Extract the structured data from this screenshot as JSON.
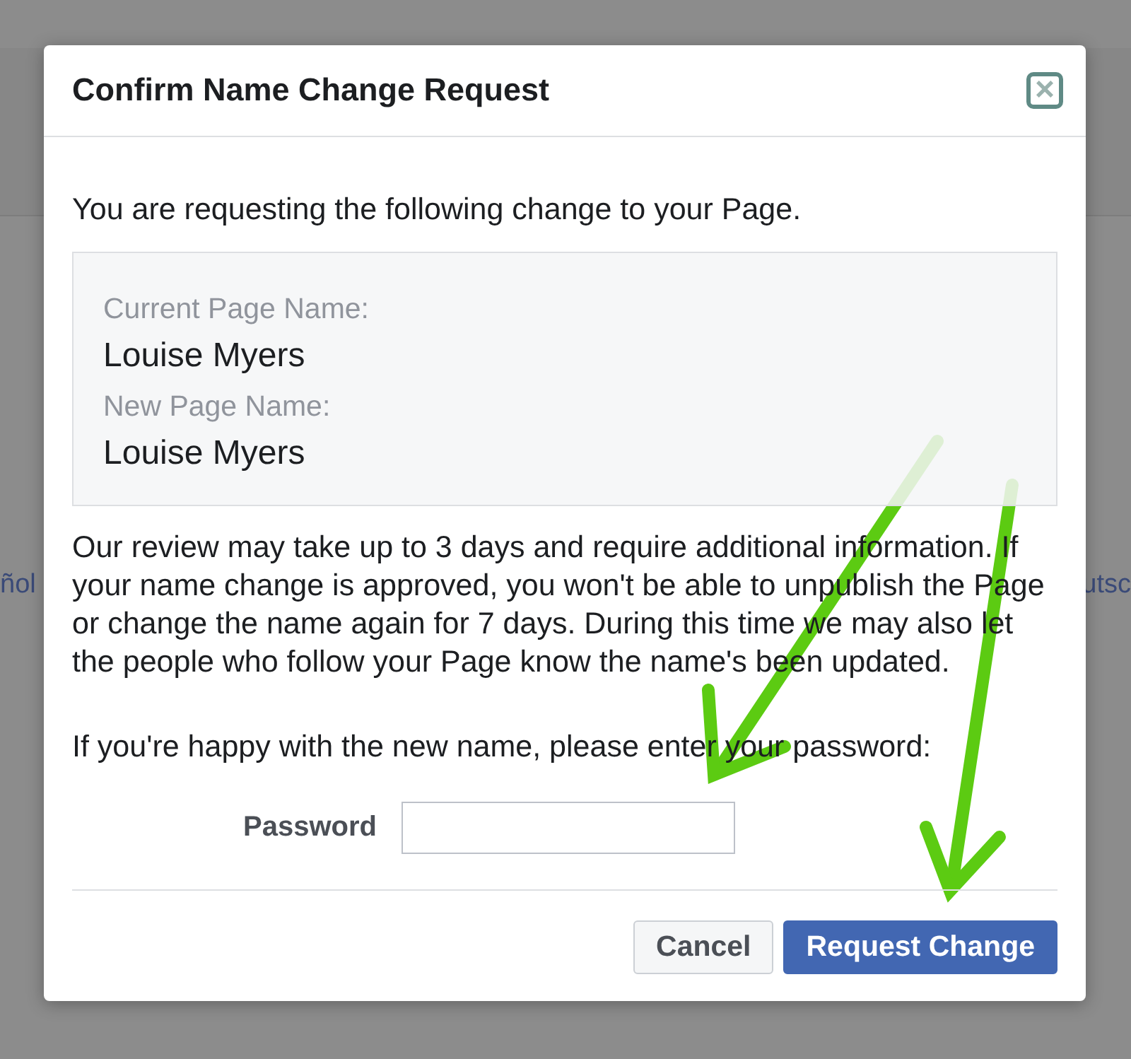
{
  "background": {
    "left_fragment": "ñol",
    "right_fragment": "utsc"
  },
  "dialog": {
    "title": "Confirm Name Change Request",
    "close_icon": "×",
    "intro": "You are requesting the following change to your Page.",
    "names": [
      {
        "label": "Current Page Name:",
        "value": "Louise Myers"
      },
      {
        "label": "New Page Name:",
        "value": "Louise Myers"
      }
    ],
    "notice": "Our review may take up to 3 days and require additional information. If your name change is approved, you won't be able to unpublish the Page or change the name again for 7 days. During this time we may also let the people who follow your Page know the name's been updated.",
    "prompt": "If you're happy with the new name, please enter your password:",
    "password": {
      "label": "Password"
    },
    "buttons": [
      {
        "label": "Cancel",
        "kind": "secondary"
      },
      {
        "label": "Request Change",
        "kind": "primary"
      }
    ]
  }
}
